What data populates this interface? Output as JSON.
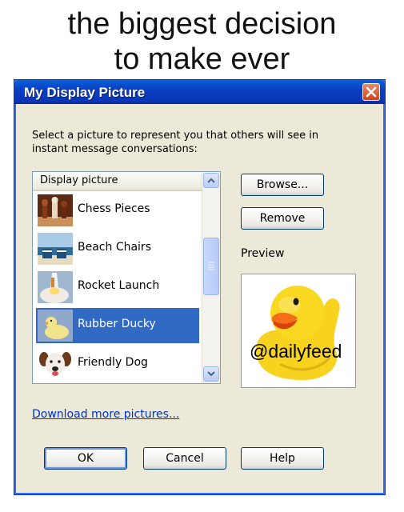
{
  "caption": {
    "line1": "the biggest decision",
    "line2": "to make ever"
  },
  "dialog": {
    "title": "My Display Picture",
    "instructions_line1": "Select a picture to represent you that others will see in",
    "instructions_line2": "instant message conversations:",
    "list": {
      "header": "Display picture",
      "items": [
        {
          "label": "Chess Pieces",
          "icon": "chess-pieces-thumbnail",
          "selected": false
        },
        {
          "label": "Beach Chairs",
          "icon": "beach-chairs-thumbnail",
          "selected": false
        },
        {
          "label": "Rocket Launch",
          "icon": "rocket-launch-thumbnail",
          "selected": false
        },
        {
          "label": "Rubber Ducky",
          "icon": "rubber-ducky-thumbnail",
          "selected": true
        },
        {
          "label": "Friendly Dog",
          "icon": "friendly-dog-thumbnail",
          "selected": false
        }
      ]
    },
    "buttons": {
      "browse": "Browse...",
      "remove": "Remove",
      "ok": "OK",
      "cancel": "Cancel",
      "help": "Help"
    },
    "preview_label": "Preview",
    "download_link": "Download more pictures..."
  },
  "watermark": "@dailyfeed",
  "colors": {
    "titlebar": "#0a3fc4",
    "selection": "#316ac5",
    "dialog_face": "#ece9d8",
    "link": "#0033cc"
  }
}
